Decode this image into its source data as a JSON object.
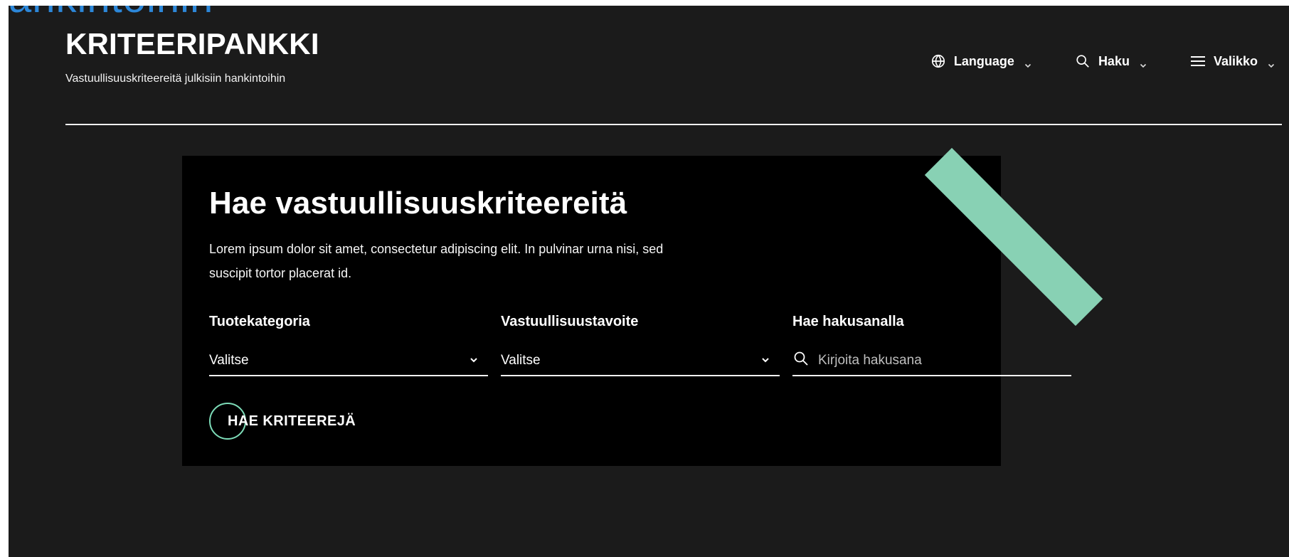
{
  "page": {
    "top_fragment": "ankintoihin"
  },
  "header": {
    "title": "KRITEERIPANKKI",
    "subtitle": "Vastuullisuuskriteereitä julkisiin hankintoihin",
    "nav": [
      {
        "label": "Language",
        "icon": "globe-icon"
      },
      {
        "label": "Haku",
        "icon": "search-icon"
      },
      {
        "label": "Valikko",
        "icon": "menu-icon"
      }
    ]
  },
  "search_card": {
    "heading": "Hae vastuullisuuskriteereitä",
    "description": "Lorem ipsum dolor sit amet, consectetur adipiscing elit. In pulvinar urna nisi, sed suscipit tortor placerat id.",
    "fields": [
      {
        "label": "Tuotekategoria",
        "value": "Valitse",
        "type": "select"
      },
      {
        "label": "Vastuullisuustavoite",
        "value": "Valitse",
        "type": "select"
      },
      {
        "label": "Hae hakusanalla",
        "placeholder": "Kirjoita hakusana",
        "type": "search"
      }
    ],
    "button_label": "HAE KRITEEREJÄ"
  },
  "colors": {
    "background": "#1b1b1b",
    "card_background": "#000000",
    "accent": "#88d1b4",
    "outline_accent": "#7ddcb8",
    "top_fragment": "#2c87d9"
  }
}
